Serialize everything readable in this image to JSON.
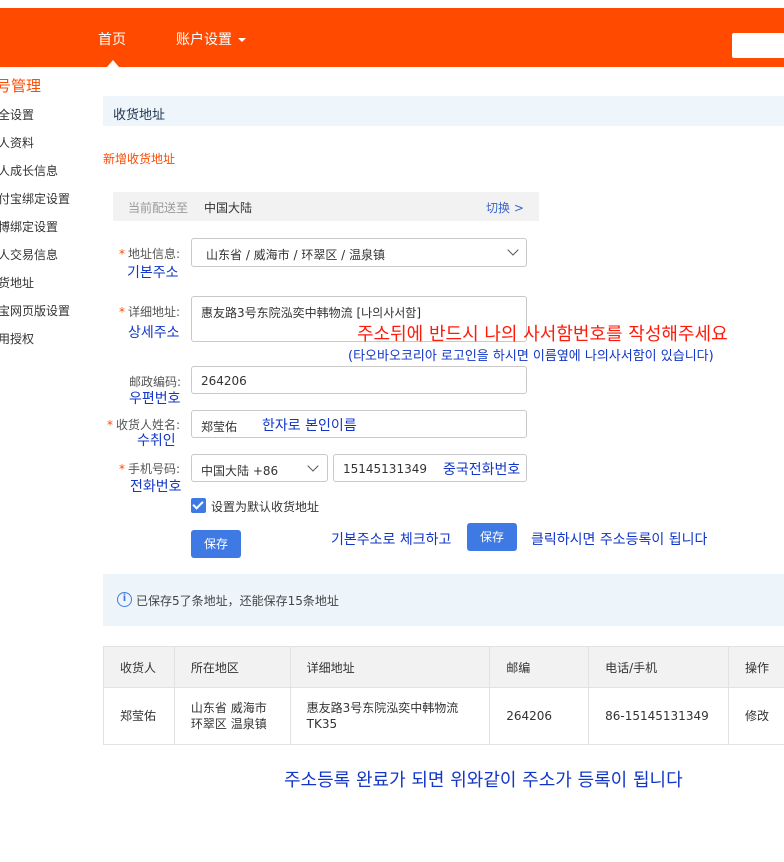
{
  "header": {
    "nav_home": "首页",
    "nav_account": "账户设置"
  },
  "sidebar": {
    "title": "号管理",
    "items": [
      "全设置",
      "人资料",
      "人成长信息",
      "付宝绑定设置",
      "博绑定设置",
      "人交易信息",
      "货地址",
      "宝网页版设置",
      "用授权"
    ]
  },
  "section": {
    "title": "收货地址",
    "new_address": "新增收货地址"
  },
  "deliver": {
    "label": "当前配送至",
    "value": "中国大陆",
    "switch": "切换 >"
  },
  "form": {
    "region_label": "地址信息:",
    "region_value": "山东省 / 威海市 / 环翠区 / 温泉镇",
    "region_kr": "기본주소",
    "detail_label": "详细地址:",
    "detail_value": "惠友路3号东院泓奕中韩物流 [나의사서함]",
    "detail_kr": "상세주소",
    "detail_note_red": "주소뒤에 반드시 나의 사서함번호를 작성해주세요",
    "detail_note_blue": "(타오바오코리아 로고인을 하시면 이름옆에 나의사서함이 있습니다)",
    "postal_label": "邮政编码:",
    "postal_value": "264206",
    "postal_kr": "우편번호",
    "name_label": "收货人姓名:",
    "name_value": "郑莹佑",
    "name_hint_kr": "한자로 본인이름",
    "name_kr": "수취인",
    "phone_label": "手机号码:",
    "phone_region": "中国大陆 +86",
    "phone_value": "15145131349",
    "phone_hint_kr": "중국전화번호",
    "phone_kr": "전화번호",
    "default_check": "设置为默认收货地址",
    "save_label": "保存",
    "instruction_before": "기본주소로 체크하고",
    "instruction_after": "클릭하시면 주소등록이 됩니다"
  },
  "notice": {
    "icon": "i",
    "text": "已保存5了条地址，还能保存15条地址"
  },
  "table": {
    "headers": [
      "收货人",
      "所在地区",
      "详细地址",
      "邮编",
      "电话/手机",
      "操作"
    ],
    "rows": [
      [
        "郑莹佑",
        "山东省 威海市 环翠区 温泉镇",
        "惠友路3号东院泓奕中韩物流 TK35",
        "264206",
        "86-15145131349",
        "修改"
      ]
    ]
  },
  "bottom_note": "주소등록 완료가 되면 위와같이 주소가 등록이 됩니다"
}
